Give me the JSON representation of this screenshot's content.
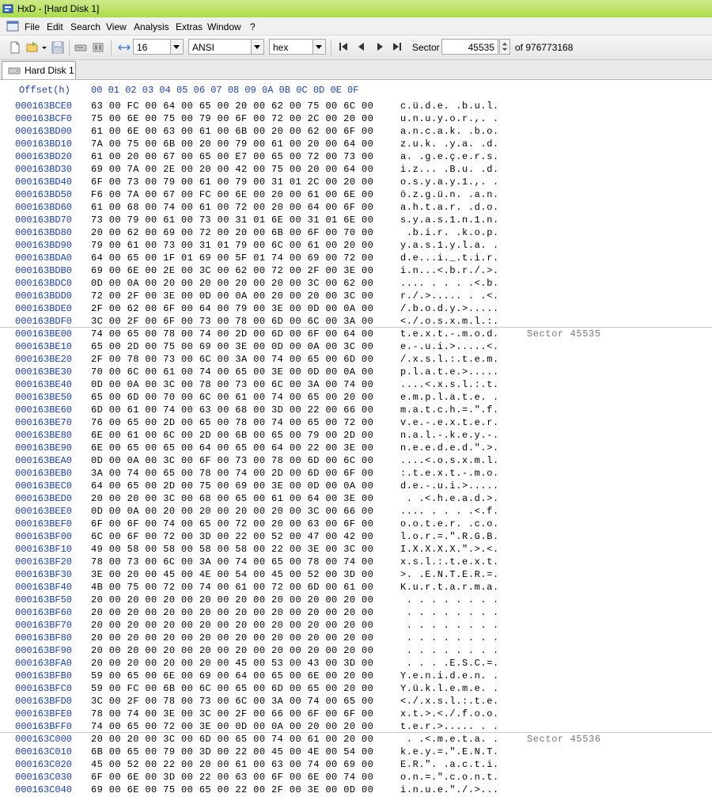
{
  "window": {
    "title": "HxD - [Hard Disk 1]"
  },
  "menu": [
    "File",
    "Edit",
    "Search",
    "View",
    "Analysis",
    "Extras",
    "Window",
    "?"
  ],
  "toolbar": {
    "bytes_per_row": "16",
    "charset": "ANSI",
    "offset_base": "hex",
    "sector_label": "Sector",
    "sector_value": "45535",
    "sector_total": "of 976773168"
  },
  "tab": {
    "label": "Hard Disk 1"
  },
  "editor": {
    "offset_header": "Offset(h)",
    "column_header": "00 01 02 03 04 05 06 07 08 09 0A 0B 0C 0D 0E 0F",
    "rows": [
      {
        "o": "000163BCE0",
        "h": "63 00 FC 00 64 00 65 00 20 00 62 00 75 00 6C 00",
        "t": "c.ü.d.e. .b.u.l."
      },
      {
        "o": "000163BCF0",
        "h": "75 00 6E 00 75 00 79 00 6F 00 72 00 2C 00 20 00",
        "t": "u.n.u.y.o.r.,. ."
      },
      {
        "o": "000163BD00",
        "h": "61 00 6E 00 63 00 61 00 6B 00 20 00 62 00 6F 00",
        "t": "a.n.c.a.k. .b.o."
      },
      {
        "o": "000163BD10",
        "h": "7A 00 75 00 6B 00 20 00 79 00 61 00 20 00 64 00",
        "t": "z.u.k. .y.a. .d."
      },
      {
        "o": "000163BD20",
        "h": "61 00 20 00 67 00 65 00 E7 00 65 00 72 00 73 00",
        "t": "a. .g.e.ç.e.r.s."
      },
      {
        "o": "000163BD30",
        "h": "69 00 7A 00 2E 00 20 00 42 00 75 00 20 00 64 00",
        "t": "i.z... .B.u. .d."
      },
      {
        "o": "000163BD40",
        "h": "6F 00 73 00 79 00 61 00 79 00 31 01 2C 00 20 00",
        "t": "o.s.y.a.y.1.,. ."
      },
      {
        "o": "000163BD50",
        "h": "F6 00 7A 00 67 00 FC 00 6E 00 20 00 61 00 6E 00",
        "t": "ö.z.g.ü.n. .a.n."
      },
      {
        "o": "000163BD60",
        "h": "61 00 68 00 74 00 61 00 72 00 20 00 64 00 6F 00",
        "t": "a.h.t.a.r. .d.o."
      },
      {
        "o": "000163BD70",
        "h": "73 00 79 00 61 00 73 00 31 01 6E 00 31 01 6E 00",
        "t": "s.y.a.s.1.n.1.n."
      },
      {
        "o": "000163BD80",
        "h": "20 00 62 00 69 00 72 00 20 00 6B 00 6F 00 70 00",
        "t": " .b.i.r. .k.o.p."
      },
      {
        "o": "000163BD90",
        "h": "79 00 61 00 73 00 31 01 79 00 6C 00 61 00 20 00",
        "t": "y.a.s.1.y.l.a. ."
      },
      {
        "o": "000163BDA0",
        "h": "64 00 65 00 1F 01 69 00 5F 01 74 00 69 00 72 00",
        "t": "d.e...i._.t.i.r."
      },
      {
        "o": "000163BDB0",
        "h": "69 00 6E 00 2E 00 3C 00 62 00 72 00 2F 00 3E 00",
        "t": "i.n...<.b.r./.>."
      },
      {
        "o": "000163BDC0",
        "h": "0D 00 0A 00 20 00 20 00 20 00 20 00 3C 00 62 00",
        "t": ".... . . . .<.b."
      },
      {
        "o": "000163BDD0",
        "h": "72 00 2F 00 3E 00 0D 00 0A 00 20 00 20 00 3C 00",
        "t": "r./.>..... . .<."
      },
      {
        "o": "000163BDE0",
        "h": "2F 00 62 00 6F 00 64 00 79 00 3E 00 0D 00 0A 00",
        "t": "/.b.o.d.y.>....."
      },
      {
        "o": "000163BDF0",
        "h": "3C 00 2F 00 6F 00 73 00 78 00 6D 00 6C 00 3A 00",
        "t": "<./.o.s.x.m.l.:."
      },
      {
        "o": "000163BE00",
        "h": "74 00 65 00 78 00 74 00 2D 00 6D 00 6F 00 64 00",
        "t": "t.e.x.t.-.m.o.d.",
        "s": "Sector 45535"
      },
      {
        "o": "000163BE10",
        "h": "65 00 2D 00 75 00 69 00 3E 00 0D 00 0A 00 3C 00",
        "t": "e.-.u.i.>.....<."
      },
      {
        "o": "000163BE20",
        "h": "2F 00 78 00 73 00 6C 00 3A 00 74 00 65 00 6D 00",
        "t": "/.x.s.l.:.t.e.m."
      },
      {
        "o": "000163BE30",
        "h": "70 00 6C 00 61 00 74 00 65 00 3E 00 0D 00 0A 00",
        "t": "p.l.a.t.e.>....."
      },
      {
        "o": "000163BE40",
        "h": "0D 00 0A 00 3C 00 78 00 73 00 6C 00 3A 00 74 00",
        "t": "....<.x.s.l.:.t."
      },
      {
        "o": "000163BE50",
        "h": "65 00 6D 00 70 00 6C 00 61 00 74 00 65 00 20 00",
        "t": "e.m.p.l.a.t.e. ."
      },
      {
        "o": "000163BE60",
        "h": "6D 00 61 00 74 00 63 00 68 00 3D 00 22 00 66 00",
        "t": "m.a.t.c.h.=.\".f."
      },
      {
        "o": "000163BE70",
        "h": "76 00 65 00 2D 00 65 00 78 00 74 00 65 00 72 00",
        "t": "v.e.-.e.x.t.e.r."
      },
      {
        "o": "000163BE80",
        "h": "6E 00 61 00 6C 00 2D 00 6B 00 65 00 79 00 2D 00",
        "t": "n.a.l.-.k.e.y.-."
      },
      {
        "o": "000163BE90",
        "h": "6E 00 65 00 65 00 64 00 65 00 64 00 22 00 3E 00",
        "t": "n.e.e.d.e.d.\".>."
      },
      {
        "o": "000163BEA0",
        "h": "0D 00 0A 00 3C 00 6F 00 73 00 78 00 6D 00 6C 00",
        "t": "....<.o.s.x.m.l."
      },
      {
        "o": "000163BEB0",
        "h": "3A 00 74 00 65 00 78 00 74 00 2D 00 6D 00 6F 00",
        "t": ":.t.e.x.t.-.m.o."
      },
      {
        "o": "000163BEC0",
        "h": "64 00 65 00 2D 00 75 00 69 00 3E 00 0D 00 0A 00",
        "t": "d.e.-.u.i.>....."
      },
      {
        "o": "000163BED0",
        "h": "20 00 20 00 3C 00 68 00 65 00 61 00 64 00 3E 00",
        "t": " . .<.h.e.a.d.>."
      },
      {
        "o": "000163BEE0",
        "h": "0D 00 0A 00 20 00 20 00 20 00 20 00 3C 00 66 00",
        "t": ".... . . . .<.f."
      },
      {
        "o": "000163BEF0",
        "h": "6F 00 6F 00 74 00 65 00 72 00 20 00 63 00 6F 00",
        "t": "o.o.t.e.r. .c.o."
      },
      {
        "o": "000163BF00",
        "h": "6C 00 6F 00 72 00 3D 00 22 00 52 00 47 00 42 00",
        "t": "l.o.r.=.\".R.G.B."
      },
      {
        "o": "000163BF10",
        "h": "49 00 58 00 58 00 58 00 58 00 22 00 3E 00 3C 00",
        "t": "I.X.X.X.X.\".>.<."
      },
      {
        "o": "000163BF20",
        "h": "78 00 73 00 6C 00 3A 00 74 00 65 00 78 00 74 00",
        "t": "x.s.l.:.t.e.x.t."
      },
      {
        "o": "000163BF30",
        "h": "3E 00 20 00 45 00 4E 00 54 00 45 00 52 00 3D 00",
        "t": ">. .E.N.T.E.R.=."
      },
      {
        "o": "000163BF40",
        "h": "4B 00 75 00 72 00 74 00 61 00 72 00 6D 00 61 00",
        "t": "K.u.r.t.a.r.m.a."
      },
      {
        "o": "000163BF50",
        "h": "20 00 20 00 20 00 20 00 20 00 20 00 20 00 20 00",
        "t": " . . . . . . . ."
      },
      {
        "o": "000163BF60",
        "h": "20 00 20 00 20 00 20 00 20 00 20 00 20 00 20 00",
        "t": " . . . . . . . ."
      },
      {
        "o": "000163BF70",
        "h": "20 00 20 00 20 00 20 00 20 00 20 00 20 00 20 00",
        "t": " . . . . . . . ."
      },
      {
        "o": "000163BF80",
        "h": "20 00 20 00 20 00 20 00 20 00 20 00 20 00 20 00",
        "t": " . . . . . . . ."
      },
      {
        "o": "000163BF90",
        "h": "20 00 20 00 20 00 20 00 20 00 20 00 20 00 20 00",
        "t": " . . . . . . . ."
      },
      {
        "o": "000163BFA0",
        "h": "20 00 20 00 20 00 20 00 45 00 53 00 43 00 3D 00",
        "t": " . . . .E.S.C.=."
      },
      {
        "o": "000163BFB0",
        "h": "59 00 65 00 6E 00 69 00 64 00 65 00 6E 00 20 00",
        "t": "Y.e.n.i.d.e.n. ."
      },
      {
        "o": "000163BFC0",
        "h": "59 00 FC 00 6B 00 6C 00 65 00 6D 00 65 00 20 00",
        "t": "Y.ü.k.l.e.m.e. ."
      },
      {
        "o": "000163BFD0",
        "h": "3C 00 2F 00 78 00 73 00 6C 00 3A 00 74 00 65 00",
        "t": "<./.x.s.l.:.t.e."
      },
      {
        "o": "000163BFE0",
        "h": "78 00 74 00 3E 00 3C 00 2F 00 66 00 6F 00 6F 00",
        "t": "x.t.>.<./.f.o.o."
      },
      {
        "o": "000163BFF0",
        "h": "74 00 65 00 72 00 3E 00 0D 00 0A 00 20 00 20 00",
        "t": "t.e.r.>..... . ."
      },
      {
        "o": "000163C000",
        "h": "20 00 20 00 3C 00 6D 00 65 00 74 00 61 00 20 00",
        "t": " . .<.m.e.t.a. .",
        "s": "Sector 45536"
      },
      {
        "o": "000163C010",
        "h": "6B 00 65 00 79 00 3D 00 22 00 45 00 4E 00 54 00",
        "t": "k.e.y.=.\".E.N.T."
      },
      {
        "o": "000163C020",
        "h": "45 00 52 00 22 00 20 00 61 00 63 00 74 00 69 00",
        "t": "E.R.\". .a.c.t.i."
      },
      {
        "o": "000163C030",
        "h": "6F 00 6E 00 3D 00 22 00 63 00 6F 00 6E 00 74 00",
        "t": "o.n.=.\".c.o.n.t."
      },
      {
        "o": "000163C040",
        "h": "69 00 6E 00 75 00 65 00 22 00 2F 00 3E 00 0D 00",
        "t": "i.n.u.e.\"./.>..."
      }
    ]
  }
}
